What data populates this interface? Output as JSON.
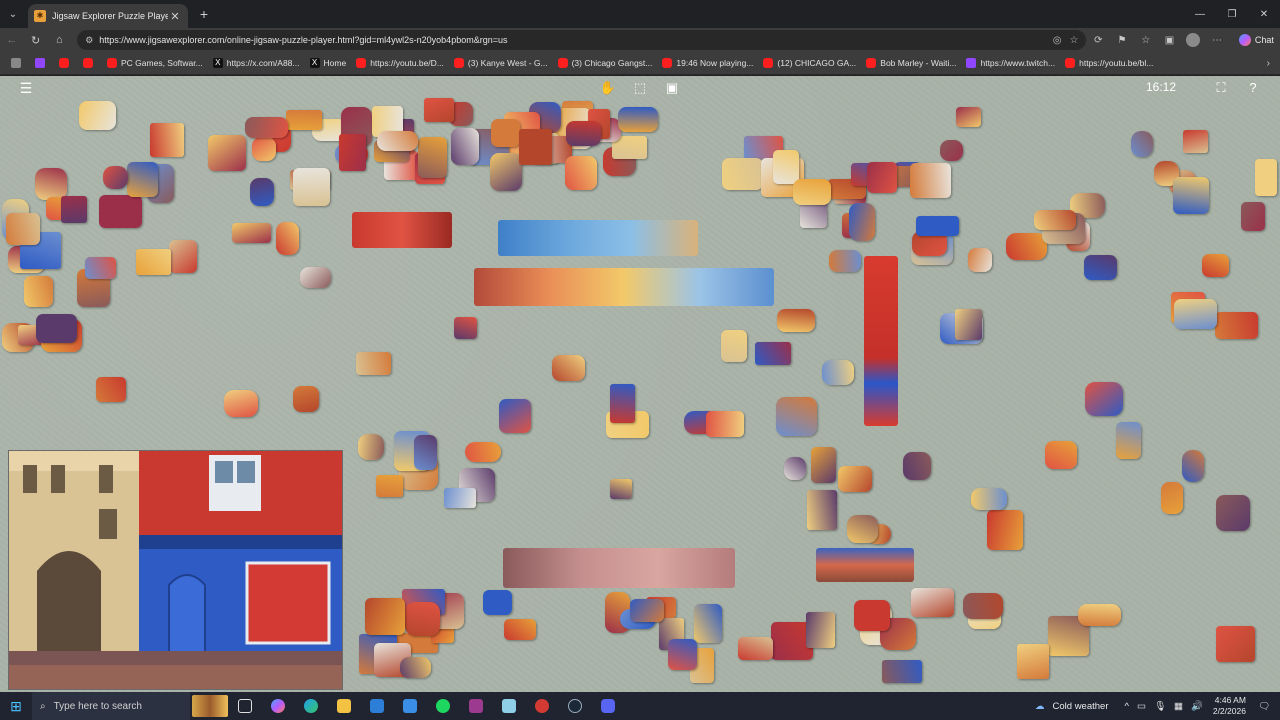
{
  "browser": {
    "tab_title": "Jigsaw Explorer Puzzle Player",
    "url": "https://www.jigsawexplorer.com/online-jigsaw-puzzle-player.html?gid=ml4ywl2s-n20yob4pbom&rgn=us",
    "chat_label": "Chat",
    "bookmarks": [
      {
        "label": "",
        "icon": "youtube-icon"
      },
      {
        "label": "",
        "icon": "twitch-icon"
      },
      {
        "label": "",
        "icon": "youtube-icon"
      },
      {
        "label": "",
        "icon": "youtube-icon"
      },
      {
        "label": "PC Games, Softwar...",
        "icon": "youtube-icon"
      },
      {
        "label": "https://x.com/A88...",
        "icon": "x-icon"
      },
      {
        "label": "Home",
        "icon": "x-icon"
      },
      {
        "label": "https://youtu.be/D...",
        "icon": "youtube-icon"
      },
      {
        "label": "(3) Kanye West - G...",
        "icon": "youtube-icon"
      },
      {
        "label": "(3) Chicago Gangst...",
        "icon": "youtube-icon"
      },
      {
        "label": "19:46 Now playing...",
        "icon": "youtube-icon"
      },
      {
        "label": "(12) CHICAGO GA...",
        "icon": "youtube-icon"
      },
      {
        "label": "Bob Marley - Waiti...",
        "icon": "youtube-icon"
      },
      {
        "label": "https://www.twitch...",
        "icon": "twitch-icon"
      },
      {
        "label": "https://youtu.be/bl...",
        "icon": "youtube-icon"
      }
    ]
  },
  "puzzle": {
    "timer": "16:12",
    "toolbar_icons": [
      "hand-icon",
      "box-select-icon",
      "image-preview-icon",
      "fullscreen-icon",
      "help-icon"
    ]
  },
  "taskbar": {
    "search_placeholder": "Type here to search",
    "weather": "Cold weather",
    "time": "4:46 AM",
    "date": "2/2/2026"
  }
}
